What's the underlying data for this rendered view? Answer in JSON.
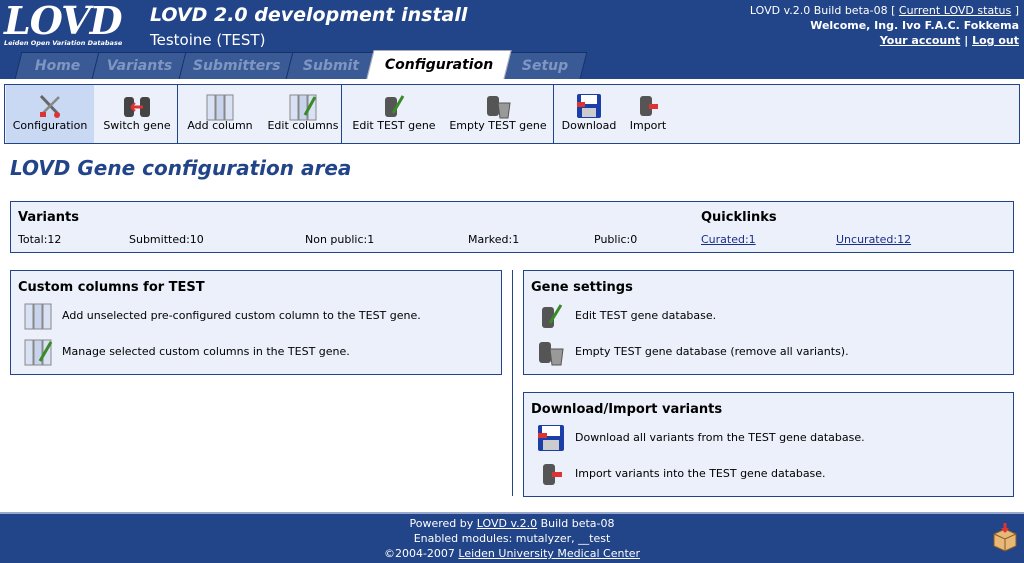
{
  "header": {
    "logo_text": "LOVD",
    "logo_subtitle": "Leiden Open Variation Database",
    "title": "LOVD 2.0 development install",
    "gene": "Testoine (TEST)",
    "version_text": "LOVD v.2.0 Build beta-08 [",
    "status_link": "Current LOVD status",
    "version_close": "]",
    "welcome": "Welcome, Ing. Ivo F.A.C. Fokkema",
    "your_account": "Your account",
    "separator": "|",
    "logout": "Log out"
  },
  "tabs": [
    {
      "label": "Home"
    },
    {
      "label": "Variants"
    },
    {
      "label": "Submitters"
    },
    {
      "label": "Submit"
    },
    {
      "label": "Configuration"
    },
    {
      "label": "Setup"
    }
  ],
  "menu": {
    "configuration": "Configuration",
    "switch_gene": "Switch gene",
    "add_column": "Add column",
    "edit_columns": "Edit columns",
    "edit_gene": "Edit TEST gene",
    "empty_gene": "Empty TEST gene",
    "download": "Download",
    "import": "Import"
  },
  "page_title": "LOVD Gene configuration area",
  "variants": {
    "heading": "Variants",
    "total": "Total:12",
    "submitted": "Submitted:10",
    "non_public": "Non public:1",
    "marked": "Marked:1",
    "public": "Public:0"
  },
  "quicklinks": {
    "heading": "Quicklinks",
    "curated": "Curated:1",
    "uncurated": "Uncurated:12"
  },
  "custom_columns": {
    "title": "Custom columns for TEST",
    "add": "Add unselected pre-configured custom column to the TEST gene.",
    "manage": "Manage selected custom columns in the TEST gene."
  },
  "gene_settings": {
    "title": "Gene settings",
    "edit": "Edit TEST gene database.",
    "empty": "Empty TEST gene database (remove all variants)."
  },
  "download_import": {
    "title": "Download/Import variants",
    "download": "Download all variants from the TEST gene database.",
    "import": "Import variants into the TEST gene database."
  },
  "footer": {
    "powered_by": "Powered by",
    "lovd_link": "LOVD v.2.0",
    "build": "Build beta-08",
    "modules": "Enabled modules: mutalyzer, __test",
    "copyright": "©2004-2007",
    "lumc_link": "Leiden University Medical Center"
  },
  "colors": {
    "header_bg": "#224488",
    "panel_bg": "#ecf0fa",
    "title_color": "#224488",
    "link_color": "#1a2e8c"
  }
}
